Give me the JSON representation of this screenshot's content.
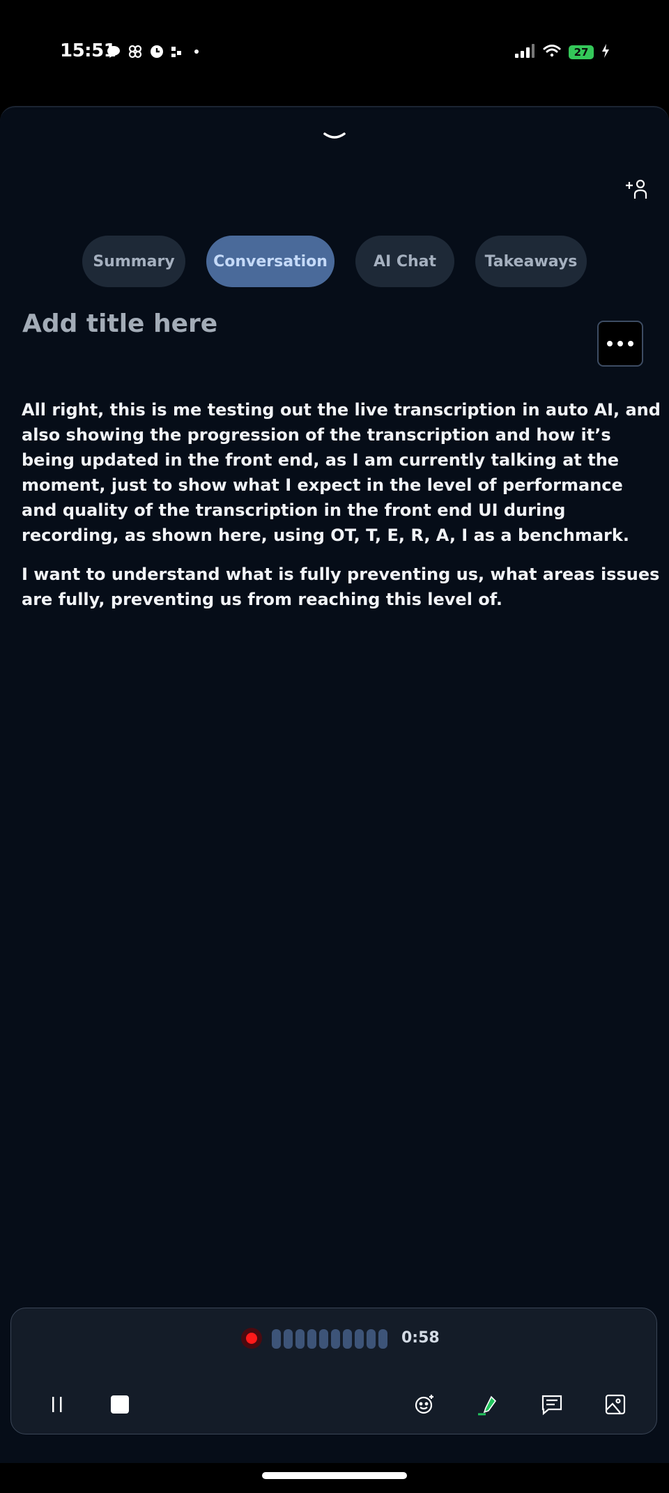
{
  "status_bar": {
    "time": "15:51",
    "battery_level": "27",
    "left_icons": [
      "bubble-icon",
      "pinwheel-icon",
      "alarm-icon",
      "grid-icon",
      "dot-icon"
    ],
    "right_icons": [
      "signal-icon",
      "wifi-icon",
      "battery-icon",
      "charging-icon"
    ]
  },
  "tabs": [
    {
      "label": "Summary",
      "active": false
    },
    {
      "label": "Conversation",
      "active": true
    },
    {
      "label": "AI Chat",
      "active": false
    },
    {
      "label": "Takeaways",
      "active": false
    }
  ],
  "title": {
    "placeholder": "Add title here",
    "value": ""
  },
  "transcript": {
    "paragraphs": [
      "All right, this is me testing out the live transcription in auto AI, and also showing the progression of the transcription and how it’s being updated in the front end, as I am currently talking at the moment, just to show what I expect in the level of performance and quality of the transcription in the front end UI during recording, as shown here, using OT, T, E, R, A, I as a benchmark.",
      "I want to understand what is fully preventing us, what areas issues are fully, preventing us from reaching this level of."
    ]
  },
  "recorder": {
    "elapsed": "0:58",
    "waveform_bars": 10,
    "controls": [
      "pause-icon",
      "stop-icon",
      "emoji-icon",
      "highlighter-icon",
      "comment-icon",
      "image-icon"
    ]
  },
  "colors": {
    "sheet_background": "#060d18",
    "tab_active": "#4a6a9a",
    "tab_inactive": "#1e2937",
    "record_red": "#ff1a1a",
    "battery_green": "#34c759",
    "highlighter_green": "#22c55e"
  }
}
